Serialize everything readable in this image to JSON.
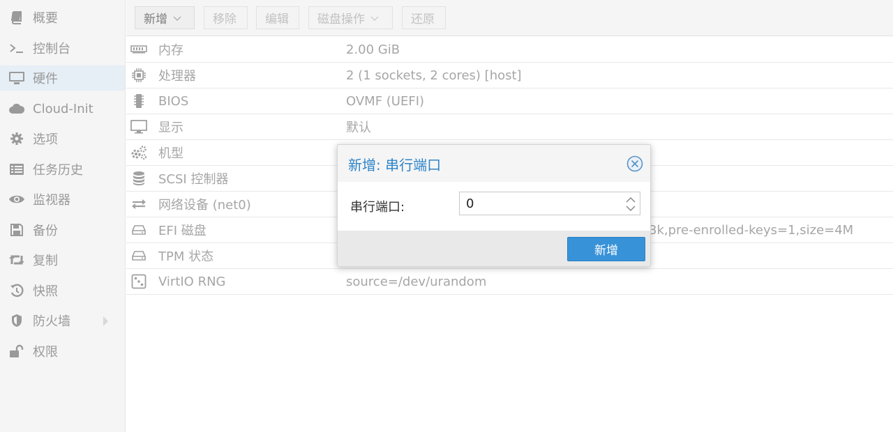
{
  "colors": {
    "accent": "#2e84c8",
    "primary_button": "#3892d8",
    "sidebar_active": "#e6eef6",
    "muted_text": "#a6a6a6"
  },
  "sidebar": {
    "items": [
      {
        "label": "概要",
        "icon": "book-icon"
      },
      {
        "label": "控制台",
        "icon": "terminal-icon"
      },
      {
        "label": "硬件",
        "icon": "monitor-icon",
        "active": true
      },
      {
        "label": "Cloud-Init",
        "icon": "cloud-icon"
      },
      {
        "label": "选项",
        "icon": "gear-icon"
      },
      {
        "label": "任务历史",
        "icon": "list-icon"
      },
      {
        "label": "监视器",
        "icon": "eye-icon"
      },
      {
        "label": "备份",
        "icon": "floppy-icon"
      },
      {
        "label": "复制",
        "icon": "retweet-icon"
      },
      {
        "label": "快照",
        "icon": "history-icon"
      },
      {
        "label": "防火墙",
        "icon": "shield-icon",
        "has_submenu": true
      },
      {
        "label": "权限",
        "icon": "unlock-icon"
      }
    ]
  },
  "toolbar": {
    "add_label": "新增",
    "remove_label": "移除",
    "edit_label": "编辑",
    "disk_action_label": "磁盘操作",
    "revert_label": "还原"
  },
  "hardware": {
    "rows": [
      {
        "name": "内存",
        "value": "2.00 GiB",
        "icon": "memory-icon"
      },
      {
        "name": "处理器",
        "value": "2 (1 sockets, 2 cores) [host]",
        "icon": "cpu-icon"
      },
      {
        "name": "BIOS",
        "value": "OVMF (UEFI)",
        "icon": "microchip-icon"
      },
      {
        "name": "显示",
        "value": "默认",
        "icon": "desktop-icon"
      },
      {
        "name": "机型",
        "value": "",
        "icon": "cogs-icon"
      },
      {
        "name": "SCSI 控制器",
        "value": "",
        "icon": "database-icon"
      },
      {
        "name": "网络设备 (net0)",
        "value": "",
        "icon": "exchange-icon"
      },
      {
        "name": "EFI 磁盘",
        "value": "3k,pre-enrolled-keys=1,size=4M",
        "icon": "hdd-icon"
      },
      {
        "name": "TPM 状态",
        "value": "",
        "icon": "hdd-icon"
      },
      {
        "name": "VirtIO RNG",
        "value": "source=/dev/urandom",
        "icon": "dice-icon"
      }
    ]
  },
  "dialog": {
    "title": "新增: 串行端口",
    "field_label": "串行端口:",
    "field_value": "0",
    "submit_label": "新增"
  }
}
